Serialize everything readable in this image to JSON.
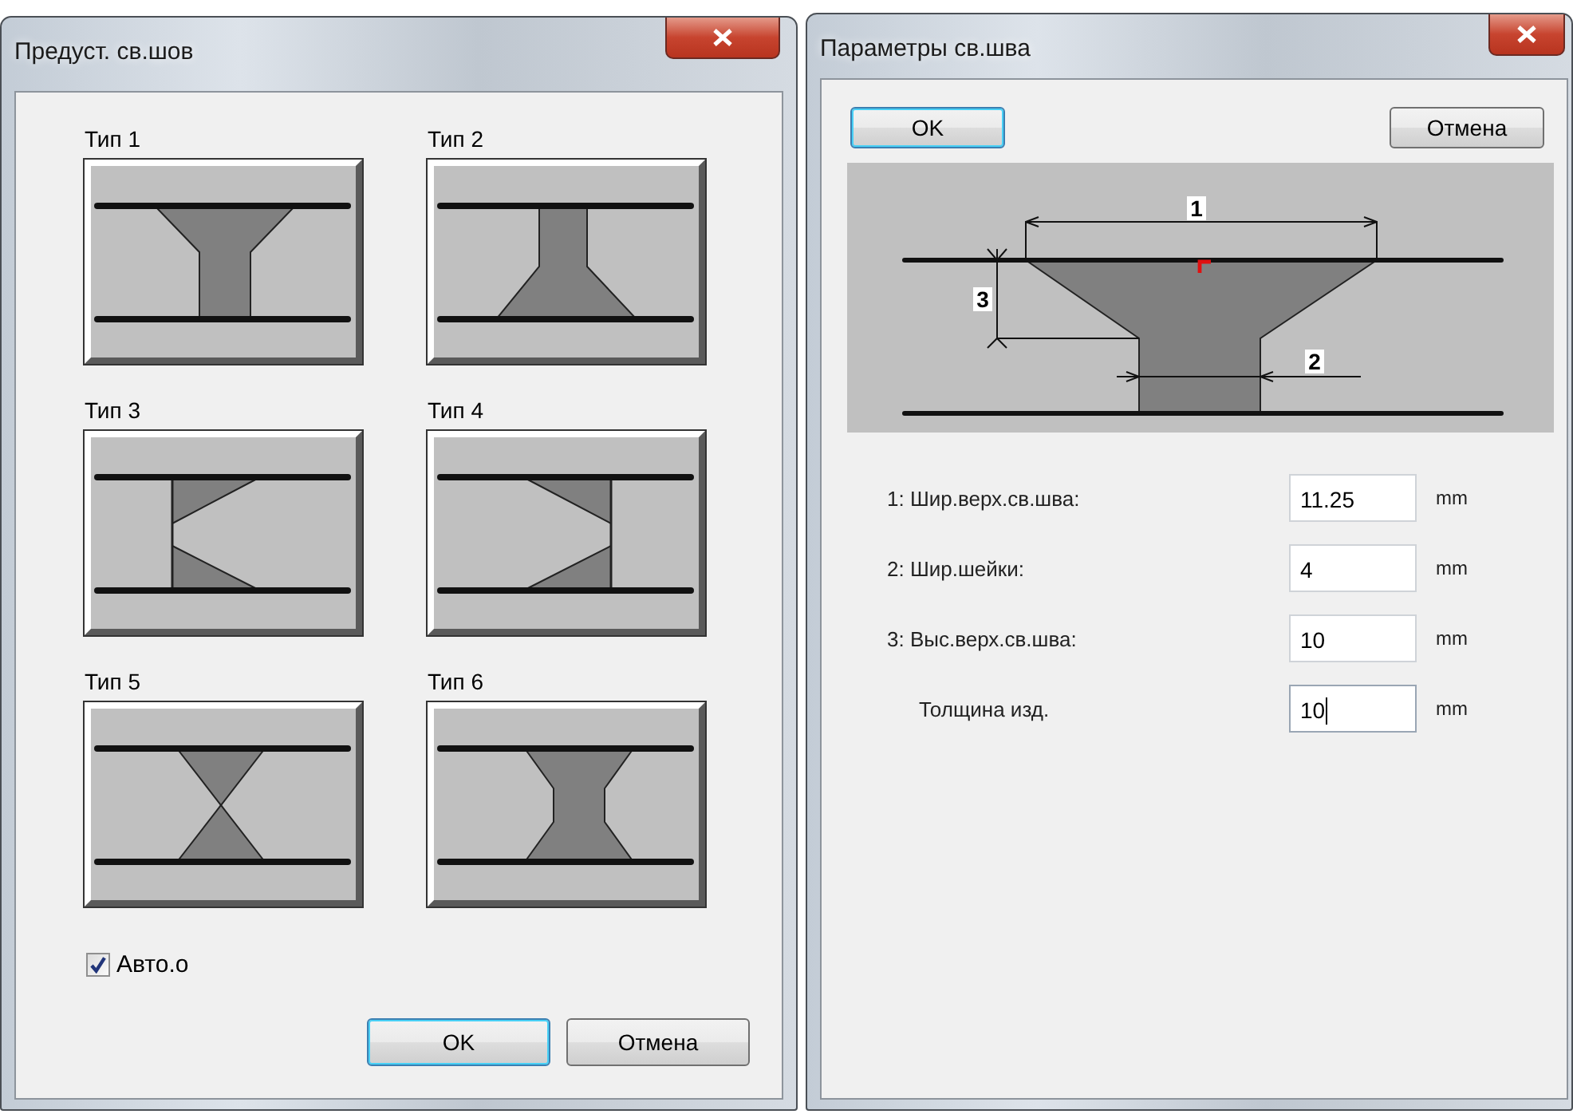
{
  "preset_dialog": {
    "title": "Предуст. св.шов",
    "weld_types": [
      {
        "label": "Тип 1",
        "kind": "y"
      },
      {
        "label": "Тип 2",
        "kind": "y-inverted"
      },
      {
        "label": "Тип 3",
        "kind": "k"
      },
      {
        "label": "Тип 4",
        "kind": "k-mirrored"
      },
      {
        "label": "Тип 5",
        "kind": "x"
      },
      {
        "label": "Тип 6",
        "kind": "double-y"
      }
    ],
    "auto_checkbox": {
      "label": "Авто.о",
      "checked": true
    },
    "buttons": [
      {
        "label": "OK",
        "default": true
      },
      {
        "label": "Отмена",
        "default": false
      }
    ]
  },
  "params_dialog": {
    "title": "Параметры св.шва",
    "buttons": [
      {
        "label": "OK",
        "default": true
      },
      {
        "label": "Отмена",
        "default": false
      }
    ],
    "diagram": {
      "labels": [
        "1",
        "2",
        "3"
      ]
    },
    "fields": [
      {
        "kind": "numbered",
        "label": "1: Шир.верх.св.шва:",
        "value": "11.25",
        "unit": "mm",
        "focused": false
      },
      {
        "kind": "numbered",
        "label": "2: Шир.шейки:",
        "value": "4",
        "unit": "mm",
        "focused": false
      },
      {
        "kind": "numbered",
        "label": "3: Выс.верх.св.шва:",
        "value": "10",
        "unit": "mm",
        "focused": false
      },
      {
        "kind": "plain",
        "label": "Толщина изд.",
        "value": "10",
        "unit": "mm",
        "focused": true
      }
    ]
  }
}
